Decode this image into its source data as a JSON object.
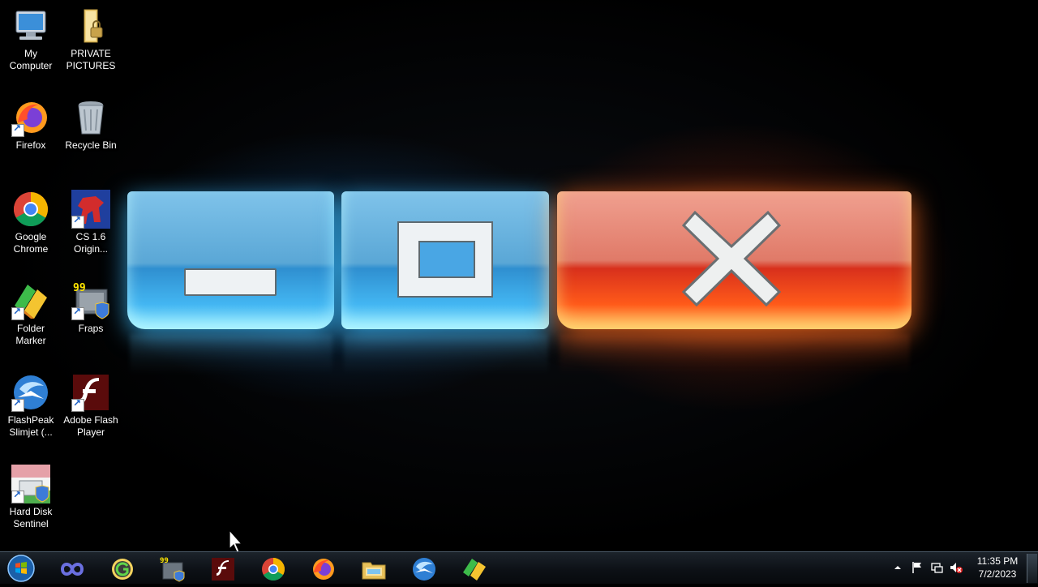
{
  "desktop": {
    "icons": [
      {
        "label": "My\nComputer",
        "icon": "computer-icon"
      },
      {
        "label": "PRIVATE\nPICTURES",
        "icon": "locked-folder-icon"
      },
      {
        "label": "Firefox",
        "icon": "firefox-icon"
      },
      {
        "label": "Recycle Bin",
        "icon": "recycle-bin-icon"
      },
      {
        "label": "Google\nChrome",
        "icon": "chrome-icon"
      },
      {
        "label": "CS 1.6\nOrigin...",
        "icon": "counter-strike-icon"
      },
      {
        "label": "Folder\nMarker",
        "icon": "folder-marker-icon"
      },
      {
        "label": "Fraps",
        "icon": "fraps-icon"
      },
      {
        "label": "FlashPeak\nSlimjet (...",
        "icon": "slimjet-icon"
      },
      {
        "label": "Adobe Flash\nPlayer",
        "icon": "flash-player-icon"
      },
      {
        "label": "Hard Disk\nSentinel",
        "icon": "hard-disk-sentinel-icon"
      }
    ],
    "wallpaper": {
      "theme": "window control buttons",
      "colors": {
        "blue": "#43b6f2",
        "red": "#ff5a1a"
      }
    }
  },
  "taskbar": {
    "start_icon": "windows-start-orb-icon",
    "pinned": [
      {
        "icon": "infinity-icon"
      },
      {
        "icon": "grammarly-icon"
      },
      {
        "icon": "fraps-icon"
      },
      {
        "icon": "flash-player-icon"
      },
      {
        "icon": "chrome-icon"
      },
      {
        "icon": "firefox-icon"
      },
      {
        "icon": "file-explorer-icon"
      },
      {
        "icon": "slimjet-icon"
      },
      {
        "icon": "folder-marker-icon"
      }
    ],
    "tray": {
      "icons": [
        "show-hidden-icons-arrow",
        "action-center-flag-icon",
        "network-icon",
        "muted-speaker-icon"
      ],
      "time": "11:35 PM",
      "date": "7/2/2023"
    }
  }
}
